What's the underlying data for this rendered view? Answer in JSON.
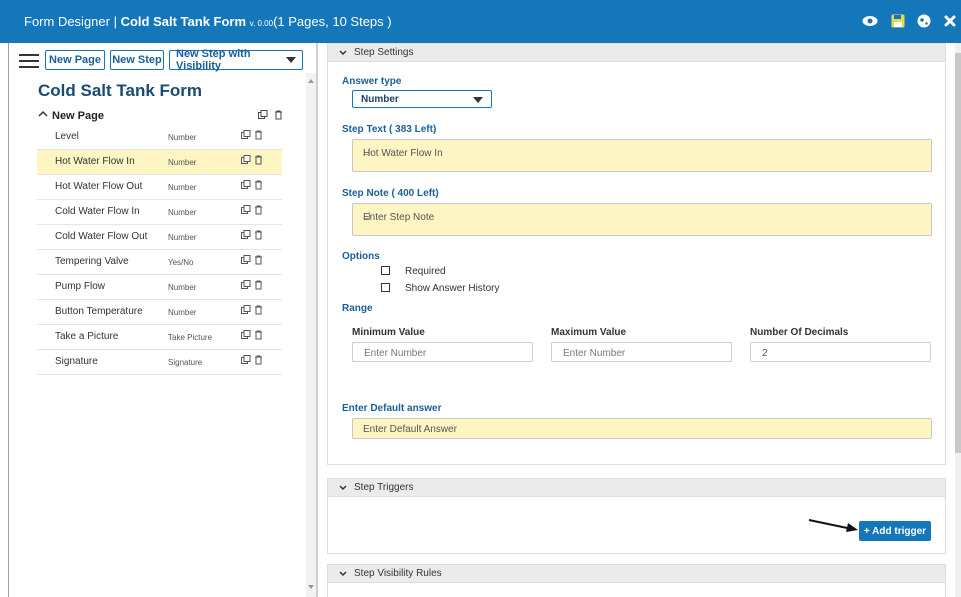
{
  "titlebar": {
    "prefix": "Form Designer |",
    "form_name": "Cold Salt Tank Form",
    "version": "v. 0.00",
    "summary": "(1 Pages, 10 Steps )",
    "icons": [
      "eye-icon",
      "save-icon",
      "globe-icon",
      "close-icon"
    ],
    "accent_color": "#1477b9"
  },
  "toolbar": {
    "new_page": "New Page",
    "new_step": "New Step",
    "new_step_visibility": "New Step with Visibility"
  },
  "form": {
    "title": "Cold Salt Tank Form",
    "page_label": "New Page",
    "steps": [
      {
        "name": "Level",
        "type": "Number"
      },
      {
        "name": "Hot Water Flow In",
        "type": "Number",
        "selected": true
      },
      {
        "name": "Hot Water Flow Out",
        "type": "Number"
      },
      {
        "name": "Cold Water Flow In",
        "type": "Number"
      },
      {
        "name": "Cold Water Flow Out",
        "type": "Number"
      },
      {
        "name": "Tempering Valve",
        "type": "Yes/No"
      },
      {
        "name": "Pump Flow",
        "type": "Number"
      },
      {
        "name": "Button Temperature",
        "type": "Number"
      },
      {
        "name": "Take a Picture",
        "type": "Take Picture"
      },
      {
        "name": "Signature",
        "type": "Signature"
      }
    ]
  },
  "step_settings": {
    "header": "Step Settings",
    "answer_type_label": "Answer type",
    "answer_type_value": "Number",
    "step_text_label": "Step Text ( 383 Left)",
    "step_text_value": "Hot Water Flow In",
    "step_note_label": "Step Note ( 400 Left)",
    "step_note_placeholder": "Enter Step Note",
    "options_label": "Options",
    "option_required": "Required",
    "option_history": "Show Answer History",
    "range_label": "Range",
    "min_label": "Minimum Value",
    "min_placeholder": "Enter Number",
    "max_label": "Maximum Value",
    "max_placeholder": "Enter Number",
    "decimals_label": "Number Of Decimals",
    "decimals_value": "2",
    "default_label": "Enter Default answer",
    "default_placeholder": "Enter Default Answer"
  },
  "step_triggers": {
    "header": "Step Triggers",
    "add_trigger": "+ Add trigger"
  },
  "step_visibility": {
    "header": "Step Visibility Rules"
  }
}
